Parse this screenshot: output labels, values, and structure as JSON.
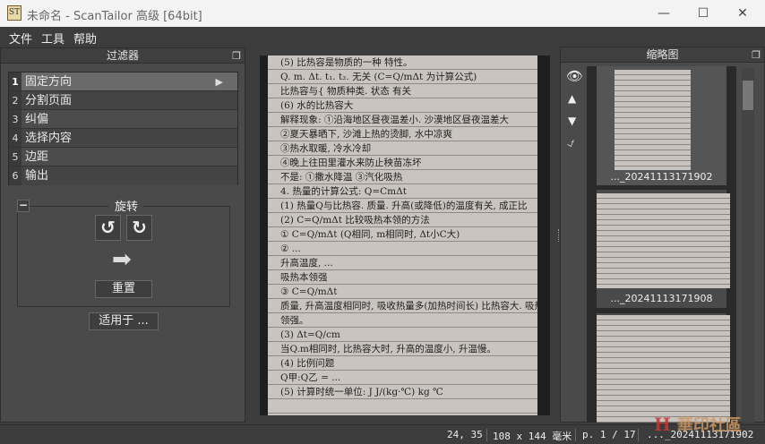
{
  "window": {
    "title": "未命名 - ScanTailor 高级 [64bit]",
    "app_icon_text": "ST",
    "minimize": "—",
    "maximize": "☐",
    "close": "✕"
  },
  "menu": [
    "文件",
    "工具",
    "帮助"
  ],
  "filters_panel": {
    "title": "过滤器",
    "items": [
      {
        "num": "1",
        "label": "固定方向"
      },
      {
        "num": "2",
        "label": "分割页面"
      },
      {
        "num": "3",
        "label": "纠偏"
      },
      {
        "num": "4",
        "label": "选择内容"
      },
      {
        "num": "5",
        "label": "边距"
      },
      {
        "num": "6",
        "label": "输出"
      }
    ]
  },
  "rotation": {
    "title": "旋转",
    "collapse": "−",
    "reset": "重置",
    "apply_to": "适用于 ..."
  },
  "page_text": [
    "(5) 比热容是物质的一种 特性。",
    "         Q. m. Δt. t₁. t₂. 无关 (C=Q/mΔt 为计算公式)",
    "比热容与{ 物质种类. 状态 有关",
    "(6) 水的比热容大",
    "解释现象: ①沿海地区昼夜温差小. 沙漠地区昼夜温差大",
    "        ②夏天暴晒下, 沙滩上热的烫脚, 水中凉爽",
    "        ③热水取暖, 冷水冷却",
    "        ④晚上往田里灌水来防止秧苗冻坏",
    "    不是: ①撒水降温  ③汽化吸热",
    "4. 热量的计算公式: Q=CmΔt",
    "(1) 热量Q与比热容. 质量. 升高(或降低)的温度有关, 成正比",
    "(2) C=Q/mΔt 比较吸热本领的方法",
    "  ① C=Q/mΔt  (Q相同, m相同时, Δt小C大)",
    "  ② ...",
    "  升高温度, ...",
    "    吸热本领强",
    "  ③ C=Q/mΔt",
    "  质量, 升高温度相同时, 吸收热量多(加热时间长) 比热容大. 吸热本",
    "  领强。",
    "  (3) Δt=Q/cm",
    "  当Q.m相同时, 比热容大时, 升高的温度小, 升温慢。",
    "  (4) 比例问题",
    "  Q甲:Q乙 = ...",
    "",
    "",
    "(5) 计算时统一单位: J  J/(kg·℃)  kg  ℃"
  ],
  "thumbnails": {
    "title": "缩略图",
    "items": [
      {
        "label": "..._20241113171902"
      },
      {
        "label": "..._20241113171908"
      },
      {
        "label": ""
      }
    ]
  },
  "thumb_tools": [
    "eye-icon",
    "arrow-up-icon",
    "arrow-down-icon",
    "deselect-icon"
  ],
  "status": {
    "coords": "24, 35",
    "size": "108 x 144 毫米",
    "page": "p. 1 / 17",
    "file": "..._20241113171902"
  },
  "watermark": {
    "text": "華印社區",
    "url": "www.52cnp.com"
  }
}
